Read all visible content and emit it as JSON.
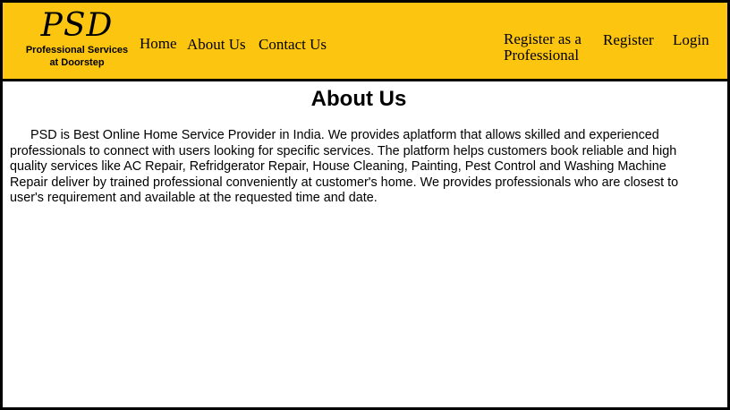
{
  "header": {
    "logo_text": "PSD",
    "tagline_line1": "Professional Services",
    "tagline_line2": "at Doorstep",
    "background_color": "#fcc610"
  },
  "nav": {
    "home": "Home",
    "about": "About Us",
    "contact": "Contact Us",
    "register_professional": "Register as a Professional",
    "register": "Register",
    "login": "Login"
  },
  "main": {
    "title": "About Us",
    "body": "PSD is Best Online Home Service Provider in India. We provides  aplatform that allows skilled and experienced professionals to connect with users looking for specific services. The platform helps customers book reliable and high quality services like AC Repair, Refridgerator Repair, House Cleaning, Painting, Pest Control and Washing Machine Repair deliver by trained professional conveniently at customer's home. We provides professionals who are closest to user's requirement and available at the requested time and date."
  }
}
